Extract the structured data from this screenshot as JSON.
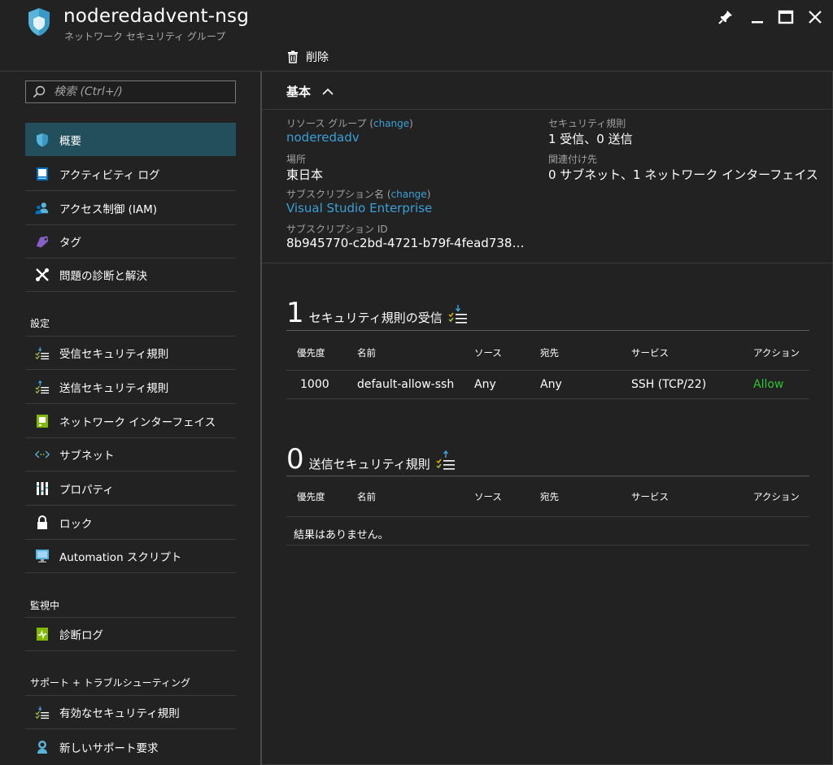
{
  "header": {
    "title": "noderedadvent-nsg",
    "subtitle": "ネットワーク セキュリティ グループ",
    "delete_label": "削除"
  },
  "search": {
    "placeholder": "検索 (Ctrl+/)"
  },
  "nav": {
    "top": [
      {
        "label": "概要",
        "icon": "shield-icon"
      },
      {
        "label": "アクティビティ ログ",
        "icon": "log-icon"
      },
      {
        "label": "アクセス制御 (IAM)",
        "icon": "users-icon"
      },
      {
        "label": "タグ",
        "icon": "tag-icon"
      },
      {
        "label": "問題の診断と解決",
        "icon": "wrench-icon"
      }
    ],
    "settings_title": "設定",
    "settings": [
      {
        "label": "受信セキュリティ規則",
        "icon": "inbound-icon"
      },
      {
        "label": "送信セキュリティ規則",
        "icon": "outbound-icon"
      },
      {
        "label": "ネットワーク インターフェイス",
        "icon": "nic-icon"
      },
      {
        "label": "サブネット",
        "icon": "subnet-icon"
      },
      {
        "label": "プロパティ",
        "icon": "properties-icon"
      },
      {
        "label": "ロック",
        "icon": "lock-icon"
      },
      {
        "label": "Automation スクリプト",
        "icon": "monitor-icon"
      }
    ],
    "monitoring_title": "監視中",
    "monitoring": [
      {
        "label": "診断ログ",
        "icon": "diagnostics-icon"
      }
    ],
    "support_title": "サポート + トラブルシューティング",
    "support": [
      {
        "label": "有効なセキュリティ規則",
        "icon": "effective-rules-icon"
      },
      {
        "label": "新しいサポート要求",
        "icon": "support-icon"
      }
    ]
  },
  "essentials": {
    "heading": "基本",
    "change": "change",
    "resource_group_label": "リソース グループ",
    "resource_group_value": "noderedadv",
    "location_label": "場所",
    "location_value": "東日本",
    "subscription_label": "サブスクリプション名",
    "subscription_value": "Visual Studio Enterprise",
    "subscription_id_label": "サブスクリプション ID",
    "subscription_id_value": "8b945770-c2bd-4721-b79f-4fead738…",
    "security_rules_label": "セキュリティ規則",
    "security_rules_value": "1 受信、0 送信",
    "associated_label": "関連付け先",
    "associated_value": "0 サブネット、1 ネットワーク インターフェイス"
  },
  "inbound": {
    "count": "1",
    "title": "セキュリティ規則の受信",
    "columns": [
      "優先度",
      "名前",
      "ソース",
      "宛先",
      "サービス",
      "アクション"
    ],
    "rows": [
      [
        "1000",
        "default-allow-ssh",
        "Any",
        "Any",
        "SSH (TCP/22)",
        "Allow"
      ]
    ]
  },
  "outbound": {
    "count": "0",
    "title": "送信セキュリティ規則",
    "columns": [
      "優先度",
      "名前",
      "ソース",
      "宛先",
      "サービス",
      "アクション"
    ],
    "empty_text": "結果はありません。"
  },
  "colors": {
    "accent": "#3aa0d8",
    "allow": "#2ec52e",
    "active_nav": "#234e5c"
  }
}
